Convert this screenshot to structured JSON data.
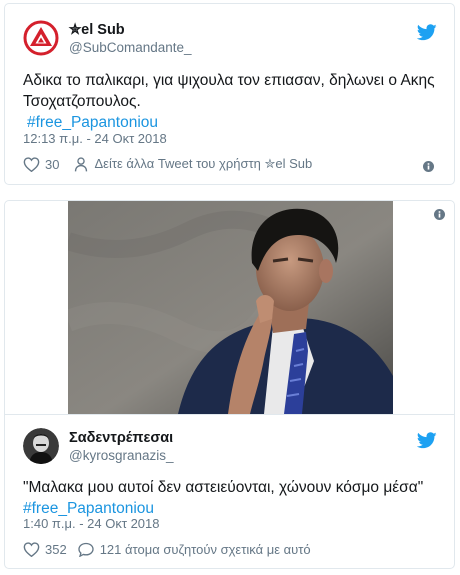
{
  "tweet1": {
    "display_name": "✮el Sub",
    "handle": "@SubComandante_",
    "text": "Αδικα το παλικαρι, για ψιχουλα τον επιασαν, δηλωνει ο Ακης Τσοχατζοπουλος.",
    "hashtag": "#free_Papantoniou",
    "timestamp": "12:13 π.μ. - 24 Οκτ 2018",
    "like_count": "30",
    "more_tweets_label": "Δείτε άλλα Tweet του χρήστη ✮el Sub"
  },
  "tweet2": {
    "display_name": "Σαδεντρέπεσαι",
    "handle": "@kyrosgranazis_",
    "text": "\"Μαλακα μου αυτοί δεν αστειεύονται, χώνουν κόσμο μέσα\"",
    "hashtag": "#free_Papantoniou",
    "timestamp": "1:40 π.μ. - 24 Οκτ 2018",
    "like_count": "352",
    "discussion_label": "121 άτομα συζητούν σχετικά με αυτό"
  },
  "colors": {
    "twitter_blue": "#1da1f2",
    "hashtag_blue": "#1b95e0",
    "secondary_text": "#657786",
    "border": "#e1e8ed",
    "logo_red": "#d4202c"
  },
  "icons": {
    "bird": "twitter-bird-icon",
    "heart": "heart-icon",
    "reply": "speech-bubble-icon",
    "profile": "person-icon",
    "info": "info-icon"
  }
}
